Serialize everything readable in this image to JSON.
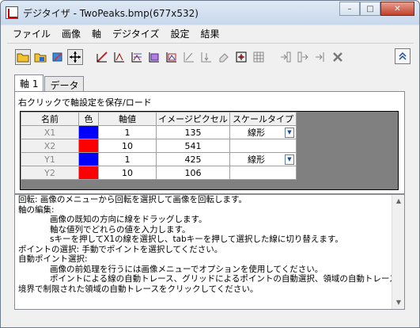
{
  "window": {
    "title": "デジタイザ - TwoPeaks.bmp(677x532)"
  },
  "menu": [
    "ファイル",
    "画像",
    "軸",
    "デジタイズ",
    "設定",
    "結果"
  ],
  "tabs": [
    "軸 1",
    "データ"
  ],
  "axis_panel": {
    "label": "右クリックで軸設定を保存/ロード",
    "columns": [
      "名前",
      "色",
      "軸値",
      "イメージピクセル",
      "スケールタイプ"
    ],
    "rows": [
      {
        "name": "X1",
        "color": "#0000ff",
        "value": "1",
        "pixel": "135",
        "scale": "線形"
      },
      {
        "name": "X2",
        "color": "#ff0000",
        "value": "10",
        "pixel": "541",
        "scale": ""
      },
      {
        "name": "Y1",
        "color": "#0000ff",
        "value": "1",
        "pixel": "425",
        "scale": "線形"
      },
      {
        "name": "Y2",
        "color": "#ff0000",
        "value": "10",
        "pixel": "106",
        "scale": ""
      }
    ]
  },
  "help_lines": [
    "回転: 画像のメニューから回転を選択して画像を回転します。",
    "軸の編集:",
    "画像の既知の方向に線をドラッグします。",
    "軸な値列でどれらの値を入力します。",
    "sキーを押してX1の線を選択し、tabキーを押して選択した線に切り替えます。",
    "ポイントの選択: 手動でポイントを選択してください。",
    "自動ポイント選択:",
    "画像の前処理を行うには画像メニューでオプションを使用してください。",
    "ポイントによる線の自動トレース、グリッドによるポイントの自動選択、領域の自動トレースまたは",
    "境界で制限された領域の自動トレースをクリックしてください。"
  ]
}
